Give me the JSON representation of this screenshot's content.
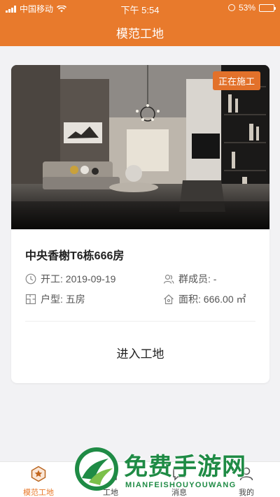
{
  "status_bar": {
    "carrier": "中国移动",
    "time": "下午 5:54",
    "battery": "53%",
    "battery_level": 0.53
  },
  "header": {
    "title": "模范工地"
  },
  "card": {
    "badge": "正在施工",
    "name": "中央香榭T6栋666房",
    "start_date": "开工: 2019-09-19",
    "members": "群成员: -",
    "layout": "户型: 五房",
    "area": "面积: 666.00 ㎡",
    "enter_label": "进入工地"
  },
  "tabs": [
    {
      "label": "模范工地",
      "icon": "star-icon",
      "active": true
    },
    {
      "label": "工地",
      "icon": "site-icon",
      "active": false
    },
    {
      "label": "消息",
      "icon": "message-icon",
      "active": false
    },
    {
      "label": "我的",
      "icon": "user-icon",
      "active": false
    }
  ],
  "watermark": {
    "text": "免费手游网",
    "subtext": "MIANFEISHOUYOUWANG"
  },
  "colors": {
    "accent": "#e87a2c",
    "watermark": "#1f8b45"
  }
}
